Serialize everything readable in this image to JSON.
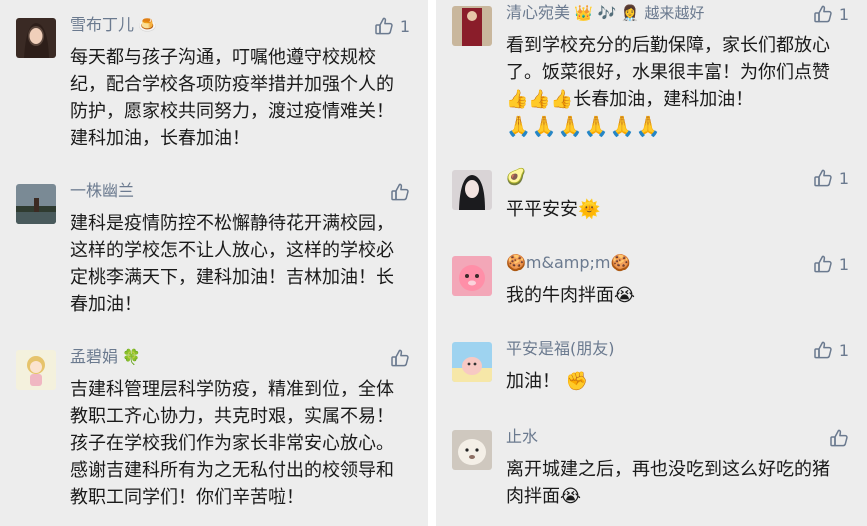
{
  "left_column": [
    {
      "username": "雪布丁儿",
      "tag": "🍮",
      "likes": "1",
      "text": "每天都与孩子沟通，叮嘱他遵守校规校纪，配合学校各项防疫举措并加强个人的防护，愿家校共同努力，渡过疫情难关！建科加油，长春加油！"
    },
    {
      "username": "一株幽兰",
      "tag": "",
      "likes": "",
      "text": "建科是疫情防控不松懈静待花开满校园，这样的学校怎不让人放心，这样的学校必定桃李满天下，建科加油！吉林加油！长春加油！"
    },
    {
      "username": "孟碧娟",
      "tag": "🍀",
      "likes": "",
      "text": "吉建科管理层科学防疫，精准到位，全体教职工齐心协力，共克时艰，实属不易！孩子在学校我们作为家长非常安心放心。感谢吉建科所有为之无私付出的校领导和教职工同学们！你们辛苦啦！"
    }
  ],
  "right_column": [
    {
      "username": "清心宛美",
      "tag": "👑 🎶 👩‍⚕️ 越来越好",
      "likes": "1",
      "text": "看到学校充分的后勤保障，家长们都放心了。饭菜很好，水果很丰富！为你们点赞👍👍👍长春加油，建科加油！",
      "emoji_line": "🙏🙏🙏🙏🙏🙏"
    },
    {
      "username": "🥑",
      "tag": "",
      "likes": "1",
      "text": "平平安安🌞"
    },
    {
      "username": "🍪m&amp;m🍪",
      "tag": "",
      "likes": "1",
      "text": "我的牛肉拌面😭"
    },
    {
      "username": "平安是福(朋友)",
      "tag": "",
      "likes": "1",
      "text": "加油！ ✊"
    },
    {
      "username": "止水",
      "tag": "",
      "likes": "",
      "text": "离开城建之后，再也没吃到这么好吃的猪肉拌面😭"
    }
  ],
  "colors": {
    "background": "#ededed",
    "name": "#6b7a8f",
    "text": "#1a1a1a",
    "divider": "#ffffff"
  }
}
